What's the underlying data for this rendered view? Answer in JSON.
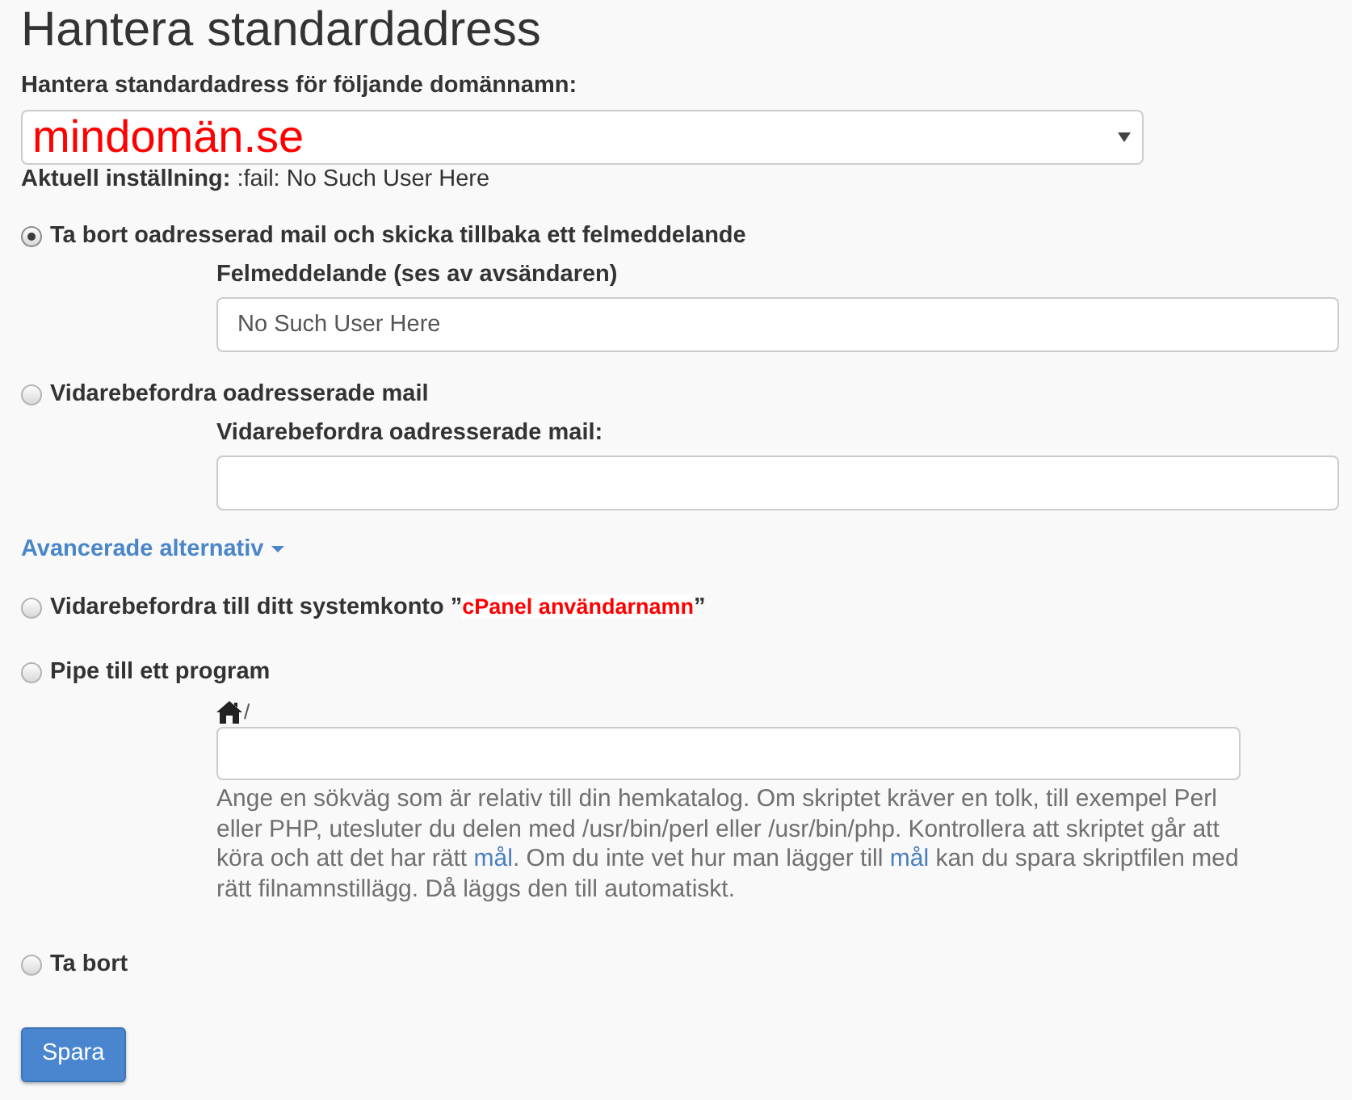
{
  "page": {
    "title": "Hantera standardadress"
  },
  "domain": {
    "label": "Hantera standardadress för följande domännamn:",
    "value": "mindomän.se"
  },
  "current_setting": {
    "label": "Aktuell inställning:",
    "value": ":fail: No Such User Here"
  },
  "options": [
    {
      "kind": "field",
      "label": "Ta bort oadresserad mail och skicka tillbaka ett felmeddelande",
      "selected": true,
      "field_label": "Felmeddelande (ses av avsändaren)",
      "field_value": "No Such User Here"
    },
    {
      "kind": "field",
      "label": "Vidarebefordra oadresserade mail",
      "selected": false,
      "field_label": "Vidarebefordra oadresserade mail:"
    }
  ],
  "advanced_toggle": "Avancerade alternativ",
  "advanced_options": [
    {
      "kind": "account",
      "label": "Vidarebefordra till ditt systemkonto ”",
      "account": "cPanel användarnamn",
      "label_end": "”",
      "selected": false
    },
    {
      "kind": "path",
      "label": "Pipe till ett program",
      "selected": false,
      "path_prefix": "/",
      "help": [
        {
          "kind": "text",
          "text": "Ange en sökväg som är relativ till din hemkatalog. Om skriptet kräver en tolk, till exempel Perl eller PHP, utesluter du delen med /usr/bin/perl eller /usr/bin/php. Kontrollera att skriptet går att köra och att det har rätt "
        },
        {
          "kind": "link",
          "text": "mål"
        },
        {
          "kind": "text",
          "text": ". Om du inte vet hur man lägger till "
        },
        {
          "kind": "link",
          "text": "mål"
        },
        {
          "kind": "text",
          "text": " kan du spara skriptfilen med rätt filnamnstillägg. Då läggs den till automatiskt."
        }
      ]
    },
    {
      "kind": "plain",
      "label": "Ta bort",
      "selected": false
    }
  ],
  "save_button": "Spara"
}
